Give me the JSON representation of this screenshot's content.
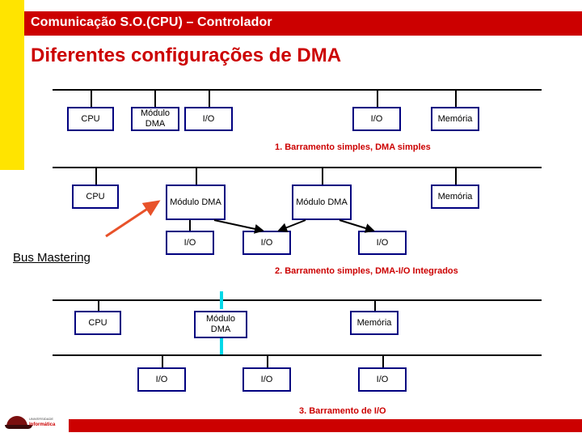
{
  "slide": {
    "header_title": "Comunicação S.O.(CPU) – Controlador",
    "subtitle": "Diferentes configurações de DMA",
    "bus_mastering_label": "Bus Mastering",
    "logo": {
      "line1": "UNIVERSIDADE",
      "line2": "Informática"
    }
  },
  "diagram1": {
    "caption": "1. Barramento simples, DMA simples",
    "boxes": [
      {
        "label": "CPU"
      },
      {
        "label": "Módulo DMA"
      },
      {
        "label": "I/O"
      },
      {
        "label": "I/O"
      },
      {
        "label": "Memória"
      }
    ]
  },
  "diagram2": {
    "caption": "2. Barramento simples, DMA-I/O Integrados",
    "boxes": [
      {
        "label": "CPU"
      },
      {
        "label": "Módulo DMA"
      },
      {
        "label": "Módulo DMA"
      },
      {
        "label": "Memória"
      },
      {
        "label": "I/O"
      },
      {
        "label": "I/O"
      },
      {
        "label": "I/O"
      }
    ]
  },
  "diagram3": {
    "caption": "3. Barramento de I/O",
    "boxes": [
      {
        "label": "CPU"
      },
      {
        "label": "Módulo DMA"
      },
      {
        "label": "Memória"
      },
      {
        "label": "I/O"
      },
      {
        "label": "I/O"
      },
      {
        "label": "I/O"
      }
    ]
  },
  "colors": {
    "accent_red": "#cc0000",
    "band_yellow": "#ffe400",
    "box_border": "#000080",
    "cyan_connector": "#00d8e8",
    "arrow_orange": "#e8522a"
  }
}
